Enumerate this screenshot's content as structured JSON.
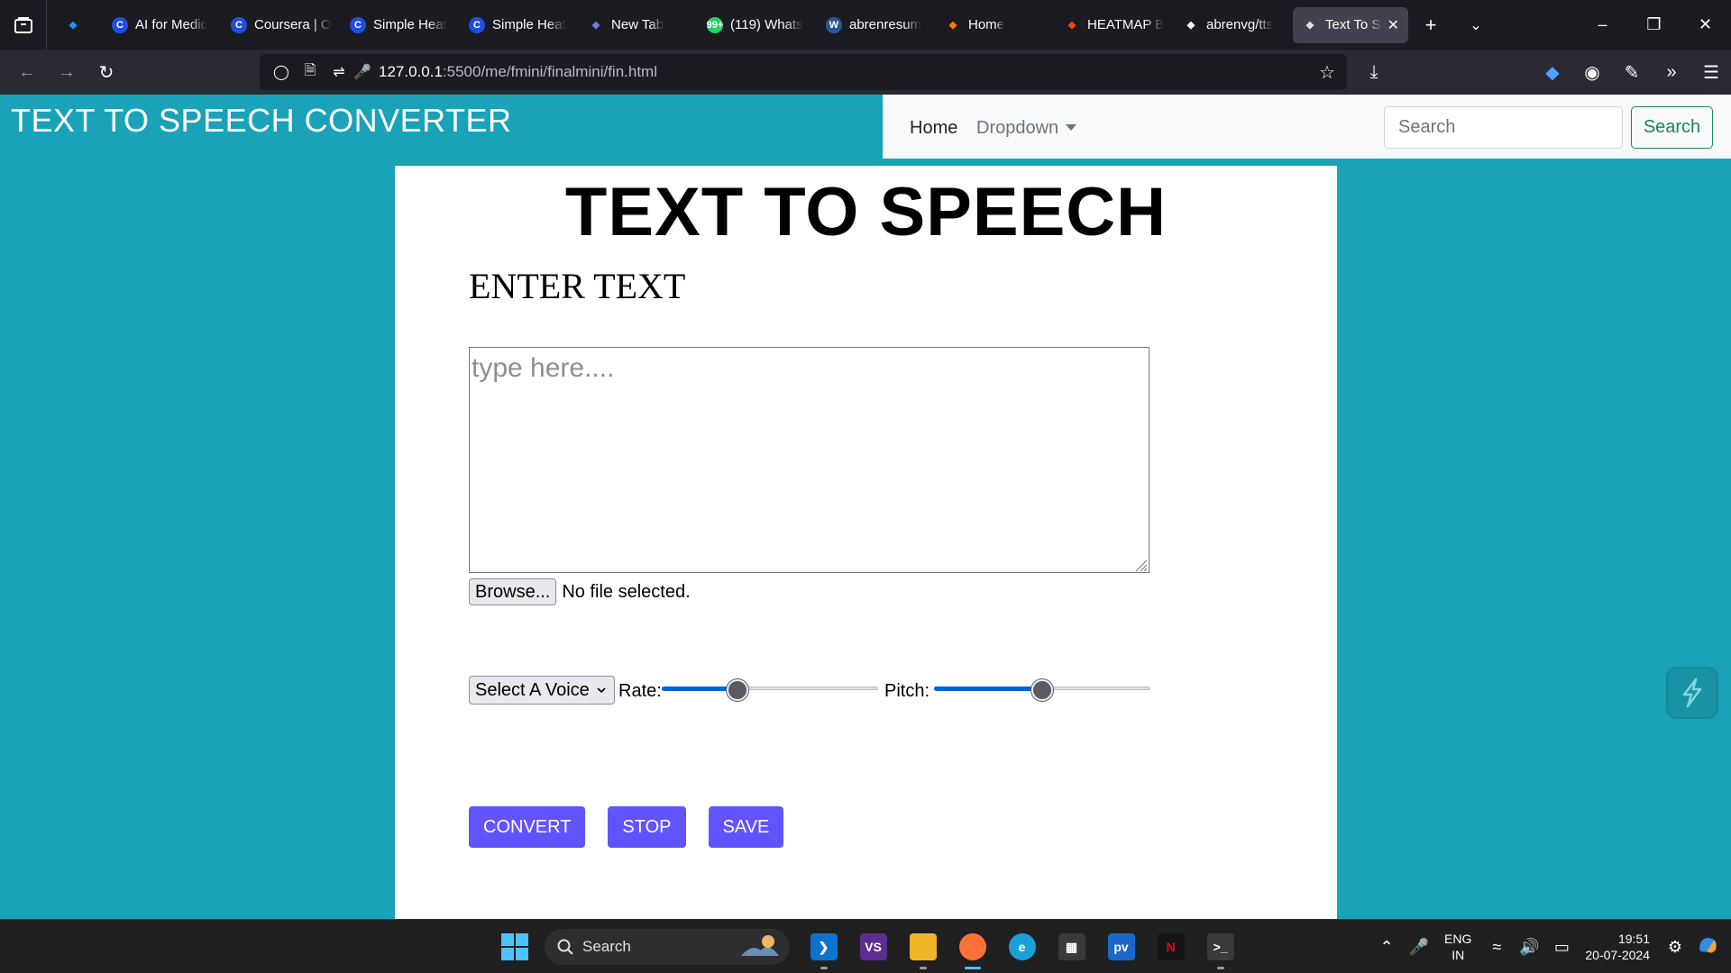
{
  "browser": {
    "tabs": [
      {
        "title": "",
        "favicon_color": "#1e90ff",
        "favicon": "gem-icon"
      },
      {
        "title": "AI for Medic",
        "favicon_color": "#1f4fe0",
        "favicon": "C"
      },
      {
        "title": "Coursera | O",
        "favicon_color": "#1f4fe0",
        "favicon": "C"
      },
      {
        "title": "Simple Heat",
        "favicon_color": "#1f4fe0",
        "favicon": "C"
      },
      {
        "title": "Simple Heat",
        "favicon_color": "#1f4fe0",
        "favicon": "C"
      },
      {
        "title": "New Tab",
        "favicon_color": "#6b7bd8",
        "favicon": "paw-icon"
      },
      {
        "title": "(119) Whats",
        "favicon_color": "#25d366",
        "favicon": "99+"
      },
      {
        "title": "abrenresum",
        "favicon_color": "#2b579a",
        "favicon": "W"
      },
      {
        "title": "Home",
        "favicon_color": "#f57c00",
        "favicon": "arc-icon"
      },
      {
        "title": "HEATMAP B",
        "favicon_color": "#e65100",
        "favicon": "book-icon"
      },
      {
        "title": "abrenvg/tts",
        "favicon_color": "#ffffff",
        "favicon": "github-icon"
      },
      {
        "title": "Text To Sp",
        "favicon_color": "#e0e0e0",
        "favicon": "tts-icon",
        "active": true
      }
    ],
    "url_host": "127.0.0.1",
    "url_path": ":5500/me/fmini/finalmini/fin.html"
  },
  "page": {
    "brand": "TEXT TO SPEECH CONVERTER",
    "nav": {
      "home": "Home",
      "dropdown": "Dropdown",
      "search_placeholder": "Search",
      "search_button": "Search"
    },
    "hero": "TEXT TO SPEECH",
    "enter_label": "ENTER TEXT",
    "textarea_placeholder": "type here....",
    "browse_button": "Browse...",
    "file_status": "No file selected.",
    "voice_select": "Select A Voice",
    "rate_label": "Rate:",
    "pitch_label": "Pitch:",
    "rate_value": 0.35,
    "pitch_value": 0.5,
    "buttons": {
      "convert": "CONVERT",
      "stop": "STOP",
      "save": "SAVE"
    },
    "colors": {
      "background": "#1aa2b8",
      "button": "#6154ff",
      "nav_search_button": "#198754"
    }
  },
  "taskbar": {
    "search": "Search",
    "apps": [
      "vscode-icon",
      "visual-studio-icon",
      "file-explorer-icon",
      "firefox-icon",
      "edge-icon",
      "store-icon",
      "prime-video-icon",
      "netflix-icon",
      "terminal-icon"
    ],
    "lang_line1": "ENG",
    "lang_line2": "IN",
    "time": "19:51",
    "date": "20-07-2024"
  }
}
